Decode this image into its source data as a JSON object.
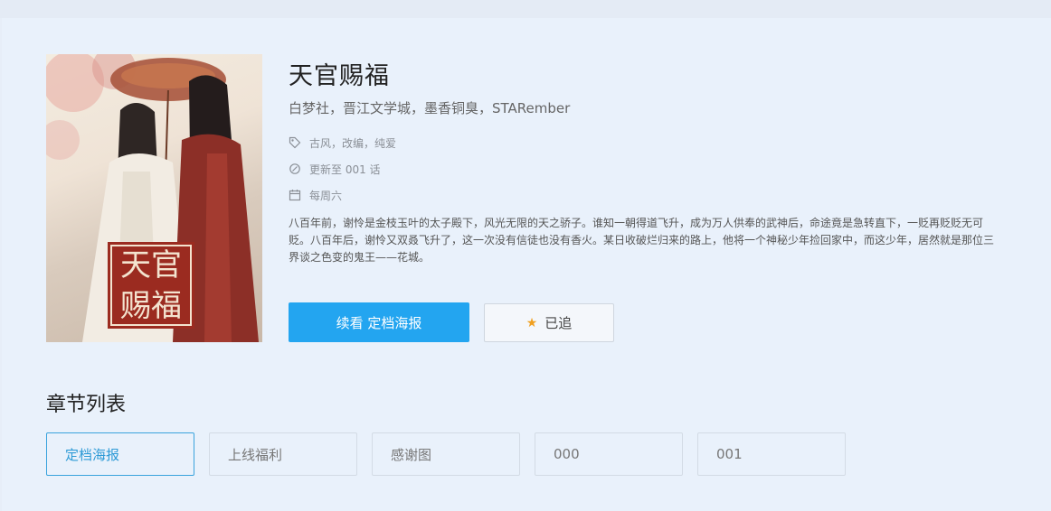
{
  "comic": {
    "title": "天官赐福",
    "authors": "白梦社，晋江文学城，墨香铜臭，STARember",
    "tags": "古风，改编，纯爱",
    "update": "更新至 001 话",
    "schedule": "每周六",
    "description": "八百年前，谢怜是金枝玉叶的太子殿下，风光无限的天之骄子。谁知一朝得道飞升，成为万人供奉的武神后，命途竟是急转直下，一贬再贬贬无可贬。八百年后，谢怜又双叒飞升了，这一次没有信徒也没有香火。某日收破烂归来的路上，他将一个神秘少年捡回家中，而这少年，居然就是那位三界谈之色变的鬼王——花城。",
    "cover_art_text": "天官赐福"
  },
  "actions": {
    "continue_label": "续看 定档海报",
    "favorite_label": "已追"
  },
  "chapters": {
    "heading": "章节列表",
    "items": [
      {
        "label": "定档海报",
        "active": true
      },
      {
        "label": "上线福利",
        "active": false
      },
      {
        "label": "感谢图",
        "active": false
      },
      {
        "label": "000",
        "active": false
      },
      {
        "label": "001",
        "active": false
      }
    ]
  },
  "colors": {
    "primary": "#23a5f0",
    "star": "#f0a020",
    "active_border": "#3aa3dd",
    "background": "#e9f1fb"
  },
  "icons": {
    "tags": "tag-icon",
    "update": "refresh-icon",
    "schedule": "calendar-icon",
    "favorite": "star-icon"
  }
}
